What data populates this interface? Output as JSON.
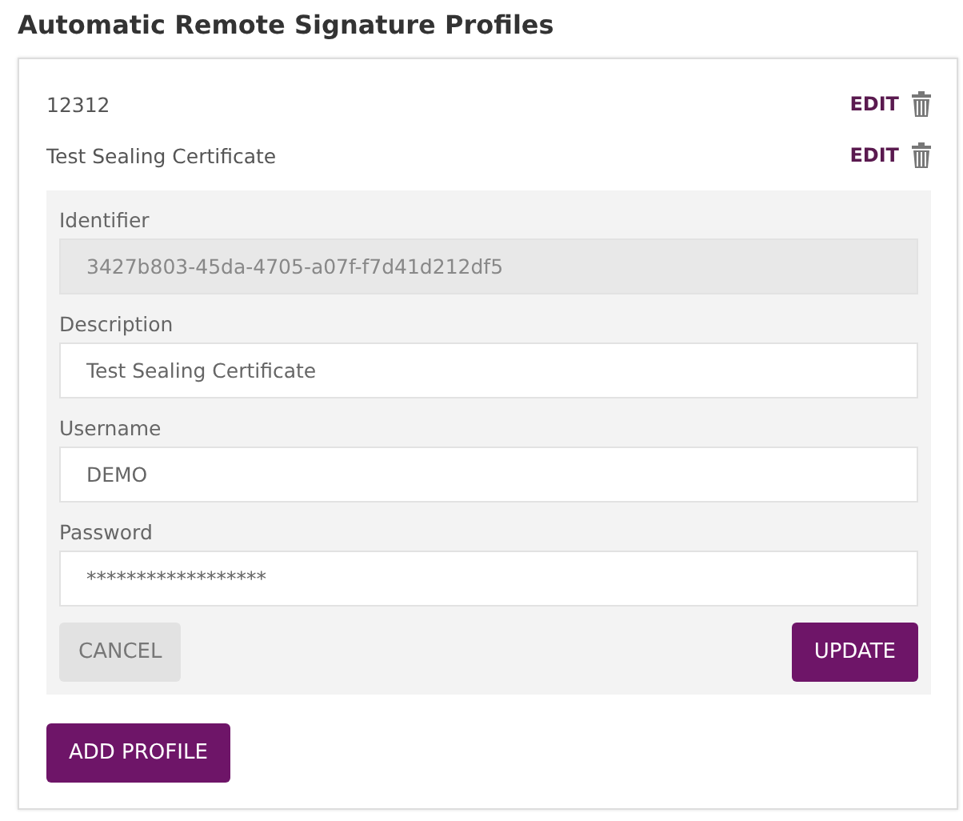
{
  "title": "Automatic Remote Signature Profiles",
  "profiles": [
    {
      "name": "12312",
      "edit": "EDIT"
    },
    {
      "name": "Test Sealing Certificate",
      "edit": "EDIT"
    }
  ],
  "form": {
    "fields": [
      {
        "label": "Identifier",
        "value": "3427b803-45da-4705-a07f-f7d41d212df5",
        "disabled": true
      },
      {
        "label": "Description",
        "value": "Test Sealing Certificate",
        "disabled": false
      },
      {
        "label": "Username",
        "value": "DEMO",
        "disabled": false
      },
      {
        "label": "Password",
        "value": "******************",
        "disabled": false
      }
    ],
    "cancel": "CANCEL",
    "update": "UPDATE"
  },
  "add_button": "ADD PROFILE"
}
